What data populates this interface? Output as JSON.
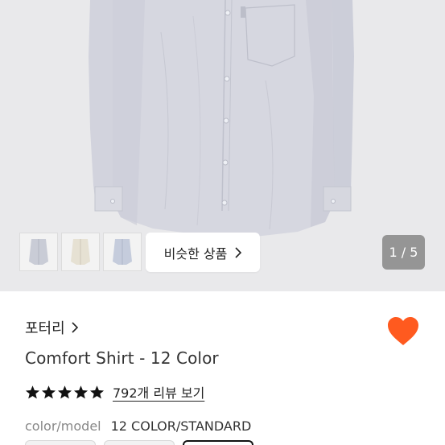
{
  "gallery": {
    "thumbnails": [
      {
        "name": "thumb-1",
        "color": "#c9ccd6"
      },
      {
        "name": "thumb-2",
        "color": "#e6e1d3"
      },
      {
        "name": "thumb-3",
        "color": "#c5ccdc"
      }
    ],
    "similar_label": "비슷한 상품",
    "counter": "1 / 5",
    "shirt_color": "#d3d4de"
  },
  "product": {
    "brand": "포터리",
    "title": "Comfort Shirt - 12 Color",
    "rating_stars": 5,
    "review_label": "792개 리뷰 보기",
    "spec_key": "color/model",
    "spec_value": "12 COLOR/STANDARD"
  },
  "colors": {
    "heart": "#ff5a1f",
    "counter_bg": "#959595"
  }
}
